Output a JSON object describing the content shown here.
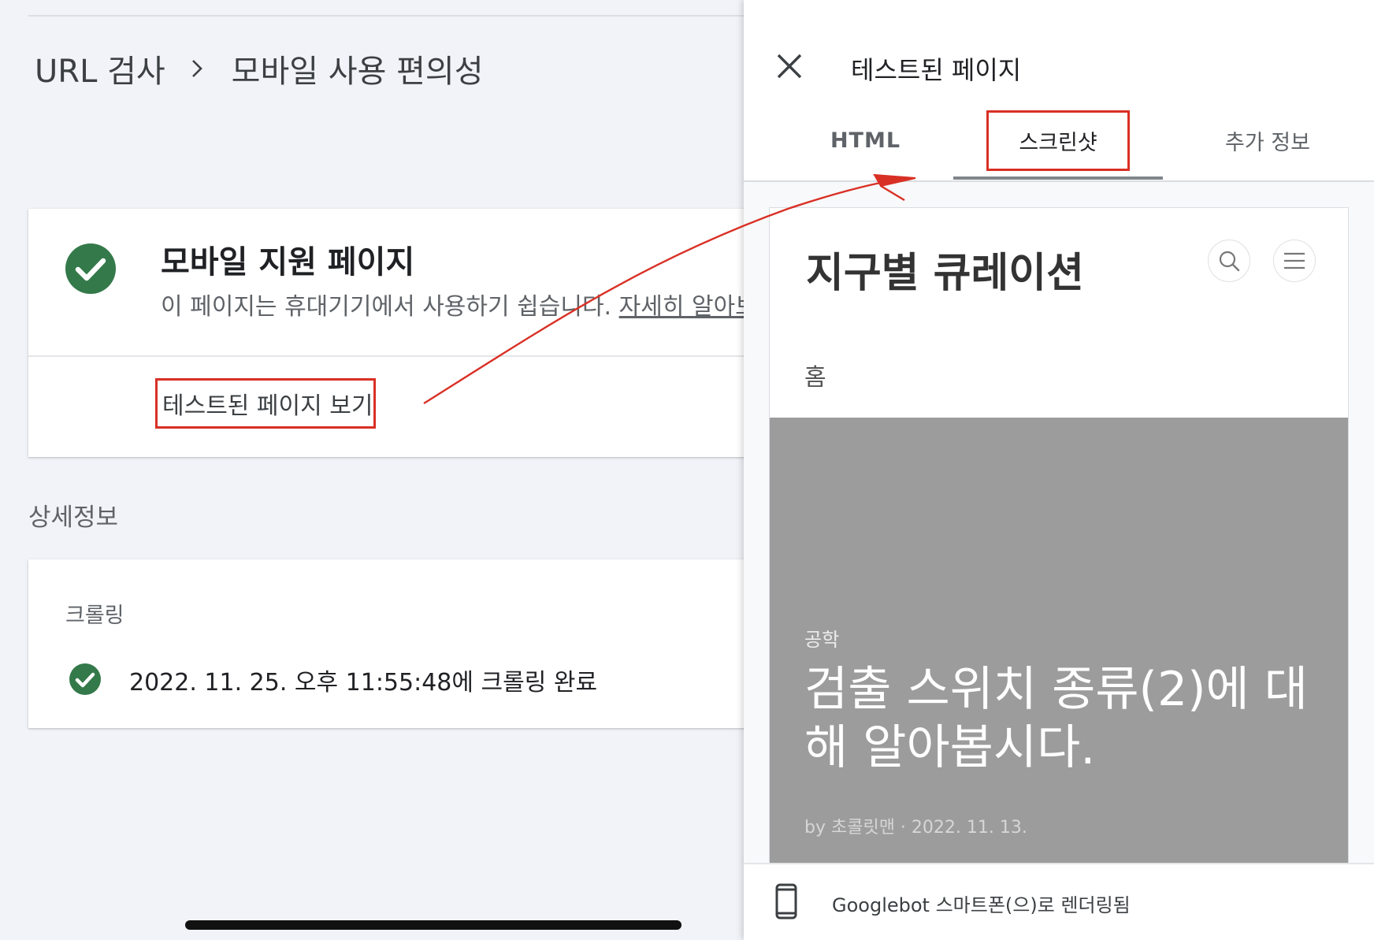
{
  "breadcrumb": {
    "parent": "URL 검사",
    "current": "모바일 사용 편의성"
  },
  "status_card": {
    "title": "모바일 지원 페이지",
    "description": "이 페이지는 휴대기기에서 사용하기 쉽습니다.",
    "learn_more": "자세히 알아보",
    "view_tested_page": "테스트된 페이지 보기"
  },
  "details": {
    "section_label": "상세정보",
    "crawl_label": "크롤링",
    "crawl_status": "2022. 11. 25. 오후 11:55:48에 크롤링 완료"
  },
  "panel": {
    "title": "테스트된 페이지",
    "tabs": [
      {
        "label": "HTML",
        "selected": false
      },
      {
        "label": "스크린샷",
        "selected": true
      },
      {
        "label": "추가 정보",
        "selected": false
      }
    ],
    "screenshot": {
      "site_title": "지구별 큐레이션",
      "nav_home": "홈",
      "category": "공학",
      "post_title": "검출 스위치 종류(2)에 대해 알아봅시다.",
      "post_meta": "by 초콜릿맨 · 2022. 11. 13."
    },
    "footer": "Googlebot 스마트폰(으)로 렌더링됨"
  },
  "colors": {
    "success_green": "#34794a",
    "annotation_red": "#d93025",
    "hero_gray": "#9c9c9c"
  },
  "icons": [
    "chevron-right-icon",
    "check-circle-icon",
    "close-icon",
    "search-icon",
    "menu-icon",
    "smartphone-icon"
  ]
}
